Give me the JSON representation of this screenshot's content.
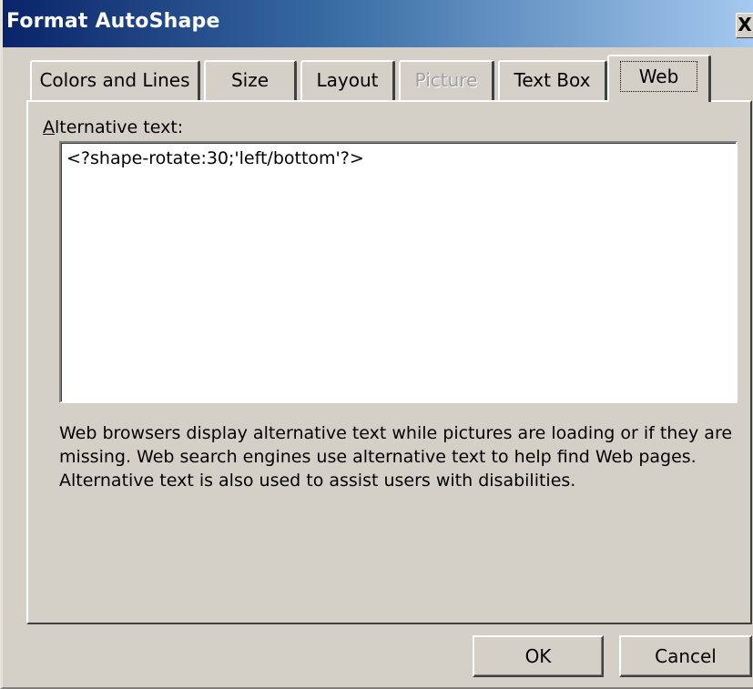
{
  "window": {
    "title": "Format AutoShape",
    "close_label": "X"
  },
  "tabs": [
    {
      "label": "Colors and Lines",
      "state": "normal"
    },
    {
      "label": "Size",
      "state": "normal"
    },
    {
      "label": "Layout",
      "state": "normal"
    },
    {
      "label": "Picture",
      "state": "disabled"
    },
    {
      "label": "Text Box",
      "state": "normal"
    },
    {
      "label": "Web",
      "state": "selected"
    }
  ],
  "web_tab": {
    "alt_text_label_accel": "A",
    "alt_text_label_rest": "lternative text:",
    "alt_text_value": "<?shape-rotate:30;'left/bottom'?>",
    "help_text": "Web browsers display alternative text while pictures are loading or if they are missing.   Web search engines use alternative text to help find Web pages.  Alternative text is also used to assist users with disabilities."
  },
  "buttons": {
    "ok": "OK",
    "cancel": "Cancel"
  },
  "colors": {
    "title_gradient_start": "#0a246a",
    "title_gradient_end": "#a6caf0",
    "dialog_face": "#d4d0c8"
  }
}
